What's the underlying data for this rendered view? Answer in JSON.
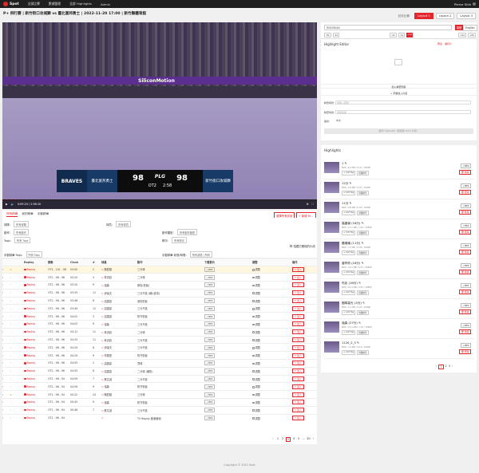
{
  "nav": {
    "brand": "Spot",
    "items": [
      "全部比賽",
      "數據整理",
      "全部 Highlights",
      "Admin"
    ],
    "user": "Pierce Shih"
  },
  "page": {
    "title": "P+ 例行賽 | 新竹街口攻城獅 vs 臺北富邦勇士 | 2022-11-20 17:00 | 新竹縣體育館"
  },
  "layouts": {
    "options": [
      "回到比賽",
      "Layout 1",
      "Layout 2",
      "Layout 3"
    ],
    "active": "Layout 1"
  },
  "video": {
    "ad": "SiliconMotion",
    "home_logo": "BRAVES",
    "home_name": "臺北富邦勇士",
    "home_score": "98",
    "league": "PLG",
    "away_score": "98",
    "away_name": "新竹街口攻城獅",
    "quarter": "OT2",
    "clock": "2:58",
    "time": "0:09:24 / 2:56:10"
  },
  "tabs": {
    "items": [
      "所有精華",
      "我的精華",
      "手動精華"
    ],
    "btn_ai": "選擇所有試用",
    "btn_new": "+ 新增 Hi..."
  },
  "filters": {
    "rows": [
      [
        {
          "label": "球隊：",
          "value": "所有球隊"
        },
        {
          "label": "球員：",
          "value": "所有球員"
        }
      ],
      [
        {
          "label": "動作：",
          "value": "所有動作"
        },
        {
          "label": "動作類型：",
          "value": "所有動作類型"
        }
      ],
      [
        {
          "label": "Tags：",
          "value": "所有 Tags"
        },
        {
          "label": "節次：",
          "value": "所有節次"
        }
      ]
    ],
    "hide_label": "隱藏已刪除的片段",
    "manual_tags_label": "手動精華 Tags：",
    "manual_tags_value": "所有 Tags",
    "manual_status_label": "手動精華 狀態/時間：",
    "manual_status_value": "所有狀態 | 所有"
  },
  "table": {
    "headers": [
      "",
      "",
      "Replay",
      "節數",
      "Clock",
      "#",
      "球員",
      "動作",
      "下載影片",
      "調整",
      "操作"
    ],
    "rows": [
      {
        "q": "OT2 - 101 - 98",
        "clock": "03:00",
        "num": "2",
        "player": "陳盈駿",
        "action": "三分球",
        "hl": true,
        "star": true
      },
      {
        "q": "OT2 - 98 - 98",
        "clock": "03:20",
        "num": "3",
        "player": "林書緯",
        "action": "二分球",
        "hl": false,
        "star": false
      },
      {
        "q": "OT2 - 98 - 98",
        "clock": "03:20",
        "num": "9",
        "player": "強森",
        "action": "助攻(籃板)",
        "hl": false,
        "star": false
      },
      {
        "q": "OT2 - 98 - 98",
        "clock": "03:35",
        "num": "11",
        "player": "伊達夫",
        "action": "三分不進 (補)(進攻)",
        "hl": false,
        "star": false
      },
      {
        "q": "OT2 - 98 - 96",
        "clock": "03:46",
        "num": "8",
        "player": "高國豪",
        "action": "進攻籃板",
        "hl": false,
        "star": false
      },
      {
        "q": "OT2 - 98 - 96",
        "clock": "03:49",
        "num": "12",
        "player": "高國豪",
        "action": "三分不進",
        "hl": false,
        "star": false
      },
      {
        "q": "OT2 - 98 - 96",
        "clock": "04:02",
        "num": "3",
        "player": "高國豪",
        "action": "防守籃板",
        "hl": false,
        "star": false
      },
      {
        "q": "OT2 - 98 - 96",
        "clock": "04:02",
        "num": "9",
        "player": "強森",
        "action": "三分不進",
        "hl": false,
        "star": false
      },
      {
        "q": "OT2 - 98 - 96",
        "clock": "04:12",
        "num": "11",
        "player": "林書緯",
        "action": "二分球",
        "hl": false,
        "star": false
      },
      {
        "q": "OT2 - 98 - 96",
        "clock": "04:25",
        "num": "11",
        "player": "林書緯",
        "action": "三分不進",
        "hl": false,
        "star": false
      },
      {
        "q": "OT2 - 98 - 96",
        "clock": "04:29",
        "num": "8",
        "player": "伊達夫",
        "action": "三分不進",
        "hl": false,
        "star": false
      },
      {
        "q": "OT2 - 98 - 96",
        "clock": "04:29",
        "num": "9",
        "player": "布蘭登",
        "action": "防守籃板",
        "hl": false,
        "star": false
      },
      {
        "q": "OT2 - 98 - 96",
        "clock": "04:55",
        "num": "2",
        "player": "高國豪",
        "action": "罰球",
        "hl": false,
        "star": false
      },
      {
        "q": "OT2 - 98 - 96",
        "clock": "04:55",
        "num": "8",
        "player": "高國豪",
        "action": "二分球 (補籃)",
        "hl": false,
        "star": false
      },
      {
        "q": "OT2 - 98 - 94",
        "clock": "04:59",
        "num": "7",
        "player": "蔡文誠",
        "action": "二分不進",
        "hl": false,
        "star": false
      },
      {
        "q": "OT2 - 98 - 94",
        "clock": "04:59",
        "num": "9",
        "player": "強森",
        "action": "防守籃板",
        "hl": false,
        "star": false
      },
      {
        "q": "OT1 - 96 - 94",
        "clock": "00:22",
        "num": "24",
        "player": "陳盈駿",
        "action": "三分球",
        "hl": false,
        "star": true
      },
      {
        "q": "OT1 - 96 - 94",
        "clock": "00:45",
        "num": "9",
        "player": "強森",
        "action": "防守籃板",
        "hl": false,
        "star": false
      },
      {
        "q": "OT1 - 96 - 94",
        "clock": "00:46",
        "num": "7",
        "player": "蔡文誠",
        "action": "三分不進",
        "hl": false,
        "star": false
      },
      {
        "q": "OT1 - 96 - 94",
        "clock": "",
        "num": "",
        "player": "",
        "action": "TV Replay 動畫畫面",
        "hl": false,
        "star": false
      }
    ],
    "replay_label": "Replay",
    "mp4_label": "MP4",
    "adjust_label": "調整",
    "add_label": "加入"
  },
  "pager": {
    "items": [
      "‹",
      "1",
      "2",
      "3",
      "4",
      "5",
      "…",
      "30",
      "›"
    ],
    "current": "3"
  },
  "editor": {
    "search_value": "RNS36464",
    "lang_active": "繁體",
    "lang_other": "English",
    "nudges_left": [
      "-5s",
      "-1s"
    ],
    "nudges_mid": [
      "-1s",
      "-1s",
      "+1s"
    ],
    "nudges_right": [
      "+1s",
      "+5s"
    ],
    "title": "Highlight Editor",
    "links": [
      "匯出",
      "儲存片"
    ],
    "btn_add": "加入精華到集",
    "btn_manual": "+ 手動加入片段",
    "fields": [
      {
        "label": "精華標題：",
        "value": "請輸入標題"
      },
      {
        "label": "精華球員：",
        "value": "選擇球員"
      },
      {
        "label": "語言：",
        "value": "中文"
      }
    ],
    "save_btn": "製作 Highlight（請選擇 0/20 片段）"
  },
  "highlights": {
    "title": "Highlights",
    "items": [
      {
        "title": "1 ✎",
        "meta": "MP4 / 8.3 MB / 0:41 / 1080P"
      },
      {
        "title": "12分 ✎",
        "meta": "MP4 / 9.6 MB / 0:47 / 1080P"
      },
      {
        "title": "11分 ✎",
        "meta": "MP4 / 8.8 MB / 0:43 / 1080P"
      },
      {
        "title": "高國豪 (18分) ✎",
        "meta": "MP4 / 12.1 MB / 1:02 / 1080P"
      },
      {
        "title": "蕭順議 (11分) ✎",
        "meta": "MP4 / 7.5 MB / 0:38 / 1080P"
      },
      {
        "title": "曾祥鈞 (16分) ✎",
        "meta": "MP4 / 10.2 MB / 0:51 / 1080P"
      },
      {
        "title": "布克 (16分) ✎",
        "meta": "MP4 / 10.9 MB / 0:55 / 1080P"
      },
      {
        "title": "團隊高光 (5分) ✎",
        "meta": "MP4 / 5.1 MB / 0:25 / 1080P"
      },
      {
        "title": "強森 (27分) ✎",
        "meta": "MP4 / 15.4 MB / 1:18 / 1080P"
      },
      {
        "title": "1120_2_3 ✎",
        "meta": "MP4 / 3.2 MB / 0:16 / 1080P"
      }
    ],
    "tag_add": "+ Add Tag",
    "tag_hide": "隱藏精華",
    "mp4_label": "MP4",
    "del_label": "刪除",
    "pager": [
      "‹",
      "1",
      "2",
      "3",
      "›"
    ],
    "pager_current": "1"
  },
  "footer": {
    "text": "Copyright © 2021 Spot"
  }
}
